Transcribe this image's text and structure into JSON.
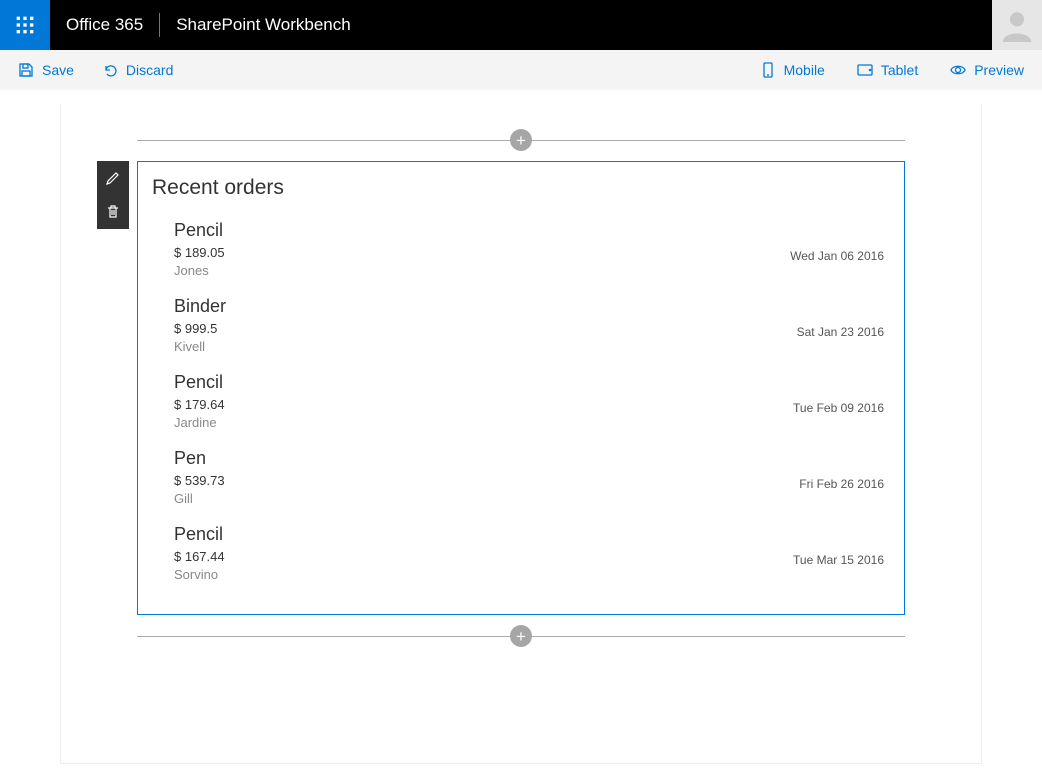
{
  "header": {
    "brand": "Office 365",
    "app": "SharePoint Workbench"
  },
  "commandbar": {
    "save": "Save",
    "discard": "Discard",
    "mobile": "Mobile",
    "tablet": "Tablet",
    "preview": "Preview"
  },
  "webpart": {
    "title": "Recent orders",
    "orders": [
      {
        "product": "Pencil",
        "price": "$ 189.05",
        "person": "Jones",
        "date": "Wed Jan 06 2016"
      },
      {
        "product": "Binder",
        "price": "$ 999.5",
        "person": "Kivell",
        "date": "Sat Jan 23 2016"
      },
      {
        "product": "Pencil",
        "price": "$ 179.64",
        "person": "Jardine",
        "date": "Tue Feb 09 2016"
      },
      {
        "product": "Pen",
        "price": "$ 539.73",
        "person": "Gill",
        "date": "Fri Feb 26 2016"
      },
      {
        "product": "Pencil",
        "price": "$ 167.44",
        "person": "Sorvino",
        "date": "Tue Mar 15 2016"
      }
    ]
  }
}
